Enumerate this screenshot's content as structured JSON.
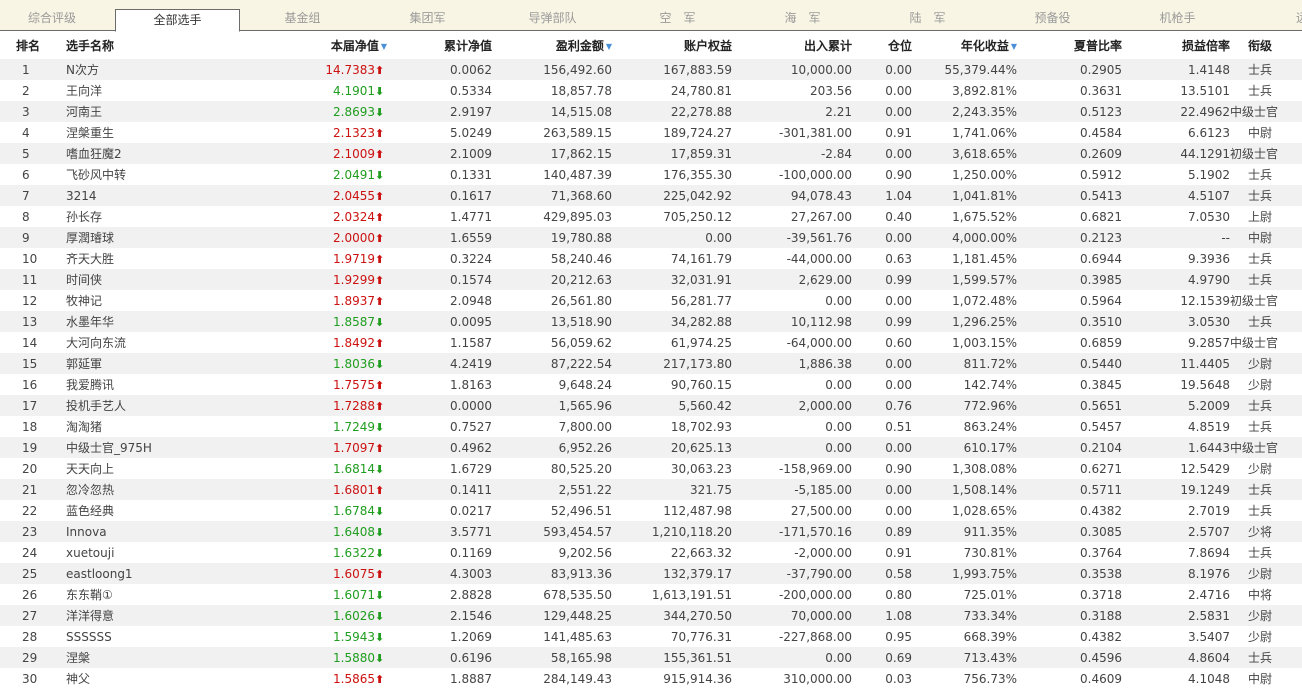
{
  "tabs": [
    {
      "label": "综合评级",
      "active": false
    },
    {
      "label": "全部选手",
      "active": true
    },
    {
      "label": "基金组",
      "active": false
    },
    {
      "label": "集团军",
      "active": false
    },
    {
      "label": "导弹部队",
      "active": false
    },
    {
      "label": "空　军",
      "active": false
    },
    {
      "label": "海　军",
      "active": false
    },
    {
      "label": "陆　军",
      "active": false
    },
    {
      "label": "预备役",
      "active": false
    },
    {
      "label": "机枪手",
      "active": false
    },
    {
      "label": "远征",
      "active": false
    }
  ],
  "columns": [
    "排名",
    "选手名称",
    "本届净值",
    "累计净值",
    "盈利金额",
    "账户权益",
    "出入累计",
    "仓位",
    "年化收益",
    "夏普比率",
    "损益倍率",
    "衔级"
  ],
  "rows": [
    {
      "rank": "1",
      "name": "N次方",
      "nav": "14.7383",
      "dir": "up",
      "cum": "0.0062",
      "profit": "156,492.60",
      "equity": "167,883.59",
      "flow": "10,000.00",
      "pos": "0.00",
      "annual": "55,379.44%",
      "sharpe": "0.2905",
      "ratio": "1.4148",
      "grade": "士兵"
    },
    {
      "rank": "2",
      "name": "王向洋",
      "nav": "4.1901",
      "dir": "down",
      "cum": "0.5334",
      "profit": "18,857.78",
      "equity": "24,780.81",
      "flow": "203.56",
      "pos": "0.00",
      "annual": "3,892.81%",
      "sharpe": "0.3631",
      "ratio": "13.5101",
      "grade": "士兵"
    },
    {
      "rank": "3",
      "name": "河南王",
      "nav": "2.8693",
      "dir": "down",
      "cum": "2.9197",
      "profit": "14,515.08",
      "equity": "22,278.88",
      "flow": "2.21",
      "pos": "0.00",
      "annual": "2,243.35%",
      "sharpe": "0.5123",
      "ratio": "22.4962",
      "grade": "中级士官"
    },
    {
      "rank": "4",
      "name": "涅槃重生",
      "nav": "2.1323",
      "dir": "up",
      "cum": "5.0249",
      "profit": "263,589.15",
      "equity": "189,724.27",
      "flow": "-301,381.00",
      "pos": "0.91",
      "annual": "1,741.06%",
      "sharpe": "0.4584",
      "ratio": "6.6123",
      "grade": "中尉"
    },
    {
      "rank": "5",
      "name": "嗜血狂魔2",
      "nav": "2.1009",
      "dir": "up",
      "cum": "2.1009",
      "profit": "17,862.15",
      "equity": "17,859.31",
      "flow": "-2.84",
      "pos": "0.00",
      "annual": "3,618.65%",
      "sharpe": "0.2609",
      "ratio": "44.1291",
      "grade": "初级士官"
    },
    {
      "rank": "6",
      "name": "飞砂风中转",
      "nav": "2.0491",
      "dir": "down",
      "cum": "0.1331",
      "profit": "140,487.39",
      "equity": "176,355.30",
      "flow": "-100,000.00",
      "pos": "0.90",
      "annual": "1,250.00%",
      "sharpe": "0.5912",
      "ratio": "5.1902",
      "grade": "士兵"
    },
    {
      "rank": "7",
      "name": "3214",
      "nav": "2.0455",
      "dir": "up",
      "cum": "0.1617",
      "profit": "71,368.60",
      "equity": "225,042.92",
      "flow": "94,078.43",
      "pos": "1.04",
      "annual": "1,041.81%",
      "sharpe": "0.5413",
      "ratio": "4.5107",
      "grade": "士兵"
    },
    {
      "rank": "8",
      "name": "孙长存",
      "nav": "2.0324",
      "dir": "up",
      "cum": "1.4771",
      "profit": "429,895.03",
      "equity": "705,250.12",
      "flow": "27,267.00",
      "pos": "0.40",
      "annual": "1,675.52%",
      "sharpe": "0.6821",
      "ratio": "7.0530",
      "grade": "上尉"
    },
    {
      "rank": "9",
      "name": "厚潤璿球",
      "nav": "2.0000",
      "dir": "up",
      "cum": "1.6559",
      "profit": "19,780.88",
      "equity": "0.00",
      "flow": "-39,561.76",
      "pos": "0.00",
      "annual": "4,000.00%",
      "sharpe": "0.2123",
      "ratio": "--",
      "grade": "中尉"
    },
    {
      "rank": "10",
      "name": "齐天大胜",
      "nav": "1.9719",
      "dir": "up",
      "cum": "0.3224",
      "profit": "58,240.46",
      "equity": "74,161.79",
      "flow": "-44,000.00",
      "pos": "0.63",
      "annual": "1,181.45%",
      "sharpe": "0.6944",
      "ratio": "9.3936",
      "grade": "士兵"
    },
    {
      "rank": "11",
      "name": "时间侠",
      "nav": "1.9299",
      "dir": "up",
      "cum": "0.1574",
      "profit": "20,212.63",
      "equity": "32,031.91",
      "flow": "2,629.00",
      "pos": "0.99",
      "annual": "1,599.57%",
      "sharpe": "0.3985",
      "ratio": "4.9790",
      "grade": "士兵"
    },
    {
      "rank": "12",
      "name": "牧神记",
      "nav": "1.8937",
      "dir": "up",
      "cum": "2.0948",
      "profit": "26,561.80",
      "equity": "56,281.77",
      "flow": "0.00",
      "pos": "0.00",
      "annual": "1,072.48%",
      "sharpe": "0.5964",
      "ratio": "12.1539",
      "grade": "初级士官"
    },
    {
      "rank": "13",
      "name": "水墨年华",
      "nav": "1.8587",
      "dir": "down",
      "cum": "0.0095",
      "profit": "13,518.90",
      "equity": "34,282.88",
      "flow": "10,112.98",
      "pos": "0.99",
      "annual": "1,296.25%",
      "sharpe": "0.3510",
      "ratio": "3.0530",
      "grade": "士兵"
    },
    {
      "rank": "14",
      "name": "大河向东流",
      "nav": "1.8492",
      "dir": "up",
      "cum": "1.1587",
      "profit": "56,059.62",
      "equity": "61,974.25",
      "flow": "-64,000.00",
      "pos": "0.60",
      "annual": "1,003.15%",
      "sharpe": "0.6859",
      "ratio": "9.2857",
      "grade": "中级士官"
    },
    {
      "rank": "15",
      "name": "郭延軍",
      "nav": "1.8036",
      "dir": "down",
      "cum": "4.2419",
      "profit": "87,222.54",
      "equity": "217,173.80",
      "flow": "1,886.38",
      "pos": "0.00",
      "annual": "811.72%",
      "sharpe": "0.5440",
      "ratio": "11.4405",
      "grade": "少尉"
    },
    {
      "rank": "16",
      "name": "我爱腾讯",
      "nav": "1.7575",
      "dir": "up",
      "cum": "1.8163",
      "profit": "9,648.24",
      "equity": "90,760.15",
      "flow": "0.00",
      "pos": "0.00",
      "annual": "142.74%",
      "sharpe": "0.3845",
      "ratio": "19.5648",
      "grade": "少尉"
    },
    {
      "rank": "17",
      "name": "投机手艺人",
      "nav": "1.7288",
      "dir": "up",
      "cum": "0.0000",
      "profit": "1,565.96",
      "equity": "5,560.42",
      "flow": "2,000.00",
      "pos": "0.76",
      "annual": "772.96%",
      "sharpe": "0.5651",
      "ratio": "5.2009",
      "grade": "士兵"
    },
    {
      "rank": "18",
      "name": "淘淘猪",
      "nav": "1.7249",
      "dir": "down",
      "cum": "0.7527",
      "profit": "7,800.00",
      "equity": "18,702.93",
      "flow": "0.00",
      "pos": "0.51",
      "annual": "863.24%",
      "sharpe": "0.5457",
      "ratio": "4.8519",
      "grade": "士兵"
    },
    {
      "rank": "19",
      "name": "中级士官_975H",
      "nav": "1.7097",
      "dir": "up",
      "cum": "0.4962",
      "profit": "6,952.26",
      "equity": "20,625.13",
      "flow": "0.00",
      "pos": "0.00",
      "annual": "610.17%",
      "sharpe": "0.2104",
      "ratio": "1.6443",
      "grade": "中级士官"
    },
    {
      "rank": "20",
      "name": "天天向上",
      "nav": "1.6814",
      "dir": "down",
      "cum": "1.6729",
      "profit": "80,525.20",
      "equity": "30,063.23",
      "flow": "-158,969.00",
      "pos": "0.90",
      "annual": "1,308.08%",
      "sharpe": "0.6271",
      "ratio": "12.5429",
      "grade": "少尉"
    },
    {
      "rank": "21",
      "name": "忽冷忽热",
      "nav": "1.6801",
      "dir": "up",
      "cum": "0.1411",
      "profit": "2,551.22",
      "equity": "321.75",
      "flow": "-5,185.00",
      "pos": "0.00",
      "annual": "1,508.14%",
      "sharpe": "0.5711",
      "ratio": "19.1249",
      "grade": "士兵"
    },
    {
      "rank": "22",
      "name": "蓝色经典",
      "nav": "1.6784",
      "dir": "down",
      "cum": "0.0217",
      "profit": "52,496.51",
      "equity": "112,487.98",
      "flow": "27,500.00",
      "pos": "0.00",
      "annual": "1,028.65%",
      "sharpe": "0.4382",
      "ratio": "2.7019",
      "grade": "士兵"
    },
    {
      "rank": "23",
      "name": "Innova",
      "nav": "1.6408",
      "dir": "down",
      "cum": "3.5771",
      "profit": "593,454.57",
      "equity": "1,210,118.20",
      "flow": "-171,570.16",
      "pos": "0.89",
      "annual": "911.35%",
      "sharpe": "0.3085",
      "ratio": "2.5707",
      "grade": "少将"
    },
    {
      "rank": "24",
      "name": "xuetouji",
      "nav": "1.6322",
      "dir": "down",
      "cum": "0.1169",
      "profit": "9,202.56",
      "equity": "22,663.32",
      "flow": "-2,000.00",
      "pos": "0.91",
      "annual": "730.81%",
      "sharpe": "0.3764",
      "ratio": "7.8694",
      "grade": "士兵"
    },
    {
      "rank": "25",
      "name": "eastloong1",
      "nav": "1.6075",
      "dir": "up",
      "cum": "4.3003",
      "profit": "83,913.36",
      "equity": "132,379.17",
      "flow": "-37,790.00",
      "pos": "0.58",
      "annual": "1,993.75%",
      "sharpe": "0.3538",
      "ratio": "8.1976",
      "grade": "少尉"
    },
    {
      "rank": "26",
      "name": "东东鞘①",
      "nav": "1.6071",
      "dir": "down",
      "cum": "2.8828",
      "profit": "678,535.50",
      "equity": "1,613,191.51",
      "flow": "-200,000.00",
      "pos": "0.80",
      "annual": "725.01%",
      "sharpe": "0.3718",
      "ratio": "2.4716",
      "grade": "中将"
    },
    {
      "rank": "27",
      "name": "洋洋得意",
      "nav": "1.6026",
      "dir": "down",
      "cum": "2.1546",
      "profit": "129,448.25",
      "equity": "344,270.50",
      "flow": "70,000.00",
      "pos": "1.08",
      "annual": "733.34%",
      "sharpe": "0.3188",
      "ratio": "2.5831",
      "grade": "少尉"
    },
    {
      "rank": "28",
      "name": "SSSSSS",
      "nav": "1.5943",
      "dir": "down",
      "cum": "1.2069",
      "profit": "141,485.63",
      "equity": "70,776.31",
      "flow": "-227,868.00",
      "pos": "0.95",
      "annual": "668.39%",
      "sharpe": "0.4382",
      "ratio": "3.5407",
      "grade": "少尉"
    },
    {
      "rank": "29",
      "name": "涅槃",
      "nav": "1.5880",
      "dir": "down",
      "cum": "0.6196",
      "profit": "58,165.98",
      "equity": "155,361.51",
      "flow": "0.00",
      "pos": "0.69",
      "annual": "713.43%",
      "sharpe": "0.4596",
      "ratio": "4.8604",
      "grade": "士兵"
    },
    {
      "rank": "30",
      "name": "神父",
      "nav": "1.5865",
      "dir": "up",
      "cum": "1.8887",
      "profit": "284,149.43",
      "equity": "915,914.36",
      "flow": "310,000.00",
      "pos": "0.03",
      "annual": "756.73%",
      "sharpe": "0.4609",
      "ratio": "4.1048",
      "grade": "中尉"
    }
  ]
}
